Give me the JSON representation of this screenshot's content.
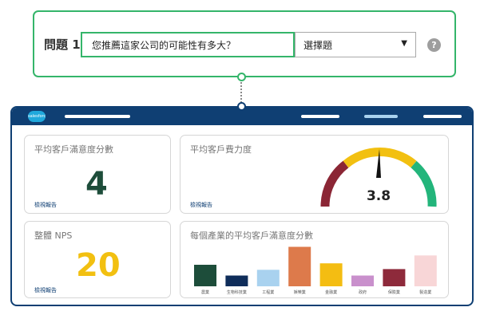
{
  "question": {
    "label": "問題 1",
    "text": "您推薦這家公司的可能性有多大？",
    "type_select": "選擇題",
    "help_icon": "?"
  },
  "dashboard": {
    "logo_text": "salesforce",
    "panels": {
      "avg_satisfaction": {
        "title": "平均客戶滿意度分數",
        "value": "4",
        "link": "檢視報告",
        "value_color": "#1d4d3a"
      },
      "avg_effort": {
        "title": "平均客戶費力度",
        "value": "3.8",
        "link": "檢視報告"
      },
      "nps": {
        "title": "整體 NPS",
        "value": "20",
        "link": "檢視報告",
        "value_color": "#f2c011"
      },
      "industry": {
        "title": "每個產業的平均客戶滿意度分數"
      }
    }
  },
  "gauge": {
    "value": 3.8,
    "min": 1,
    "max": 5,
    "segment_colors": [
      "#8b2635",
      "#f2c011",
      "#23b57b"
    ]
  },
  "chart_data": {
    "type": "bar",
    "title": "每個產業的平均客戶滿意度分數",
    "categories": [
      "農業",
      "生物科技業",
      "工程業",
      "娛樂業",
      "金融業",
      "政府",
      "保險業",
      "製造業"
    ],
    "values": [
      3.0,
      1.5,
      2.3,
      5.5,
      3.2,
      1.5,
      2.4,
      4.3
    ],
    "colors": [
      "#1d4d3a",
      "#0f2d5a",
      "#a9d2ef",
      "#dd7a4b",
      "#f4bd12",
      "#c990cc",
      "#8e2a3b",
      "#f8d6d7"
    ],
    "ylim": [
      0,
      6
    ],
    "grid": false
  }
}
